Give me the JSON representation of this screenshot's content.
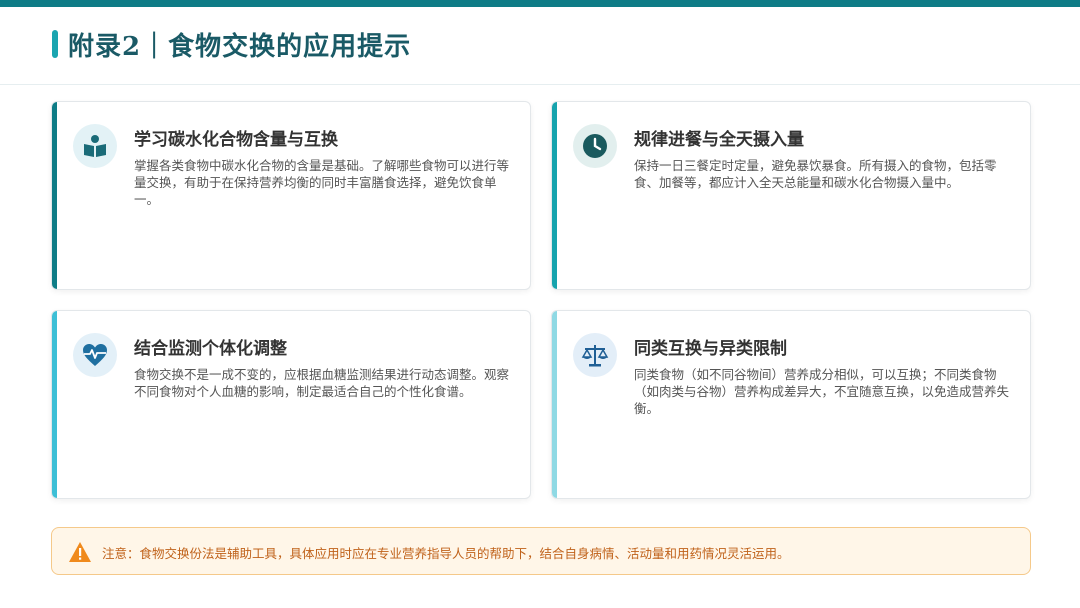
{
  "header": {
    "title": "附录2｜食物交换的应用提示"
  },
  "colors": {
    "top_bar": "#0e7c86",
    "title": "#1a5a66",
    "icon_fill": "#1a6b78",
    "note_text": "#c0621a",
    "warning_icon": "#f08a1c"
  },
  "cards": [
    {
      "icon": "book-reader-icon",
      "edge_color": "#0e7c86",
      "title": "学习碳水化合物含量与互换",
      "text": "掌握各类食物中碳水化合物的含量是基础。了解哪些食物可以进行等量交换，有助于在保持营养均衡的同时丰富膳食选择，避免饮食单一。"
    },
    {
      "icon": "clock-icon",
      "edge_color": "#16a3ad",
      "title": "规律进餐与全天摄入量",
      "text": "保持一日三餐定时定量，避免暴饮暴食。所有摄入的食物，包括零食、加餐等，都应计入全天总能量和碳水化合物摄入量中。"
    },
    {
      "icon": "heart-pulse-icon",
      "edge_color": "#3dbfd6",
      "title": "结合监测个体化调整",
      "text": "食物交换不是一成不变的，应根据血糖监测结果进行动态调整。观察不同食物对个人血糖的影响，制定最适合自己的个性化食谱。"
    },
    {
      "icon": "balance-scale-icon",
      "edge_color": "#8fd9e4",
      "title": "同类互换与异类限制",
      "text": "同类食物（如不同谷物间）营养成分相似，可以互换；不同类食物（如肉类与谷物）营养构成差异大，不宜随意互换，以免造成营养失衡。"
    }
  ],
  "note": {
    "icon": "warning-icon",
    "text": "注意：食物交换份法是辅助工具，具体应用时应在专业营养指导人员的帮助下，结合自身病情、活动量和用药情况灵活运用。"
  }
}
